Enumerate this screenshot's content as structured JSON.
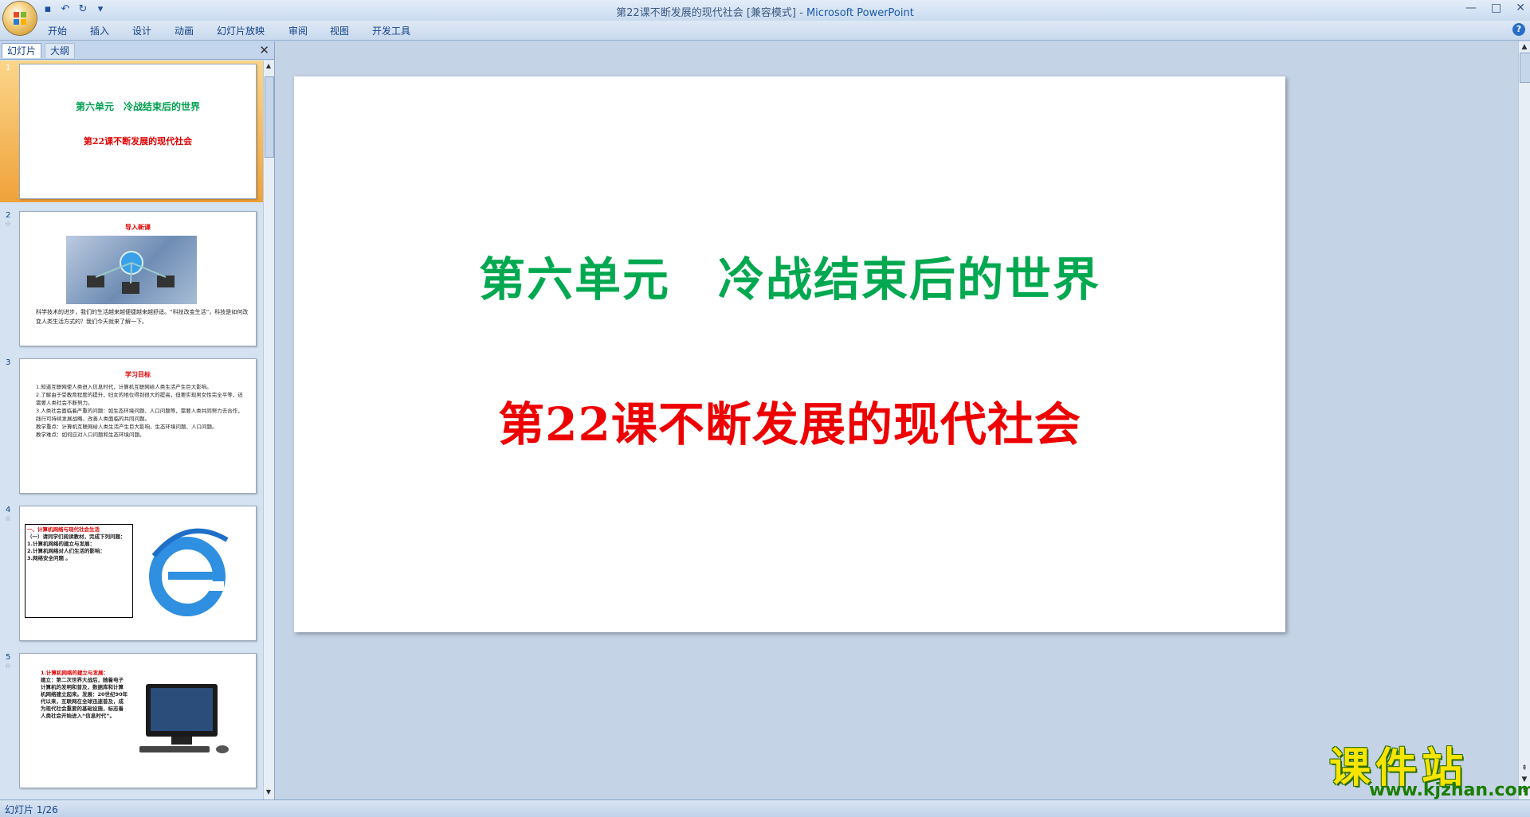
{
  "window": {
    "title": "第22课不断发展的现代社会 [兼容模式]",
    "app_name": "Microsoft PowerPoint",
    "controls": [
      "—",
      "□",
      "✕"
    ]
  },
  "ribbon": {
    "tabs": [
      "开始",
      "插入",
      "设计",
      "动画",
      "幻灯片放映",
      "审阅",
      "视图",
      "开发工具"
    ]
  },
  "left_panel": {
    "tab_slides": "幻灯片",
    "tab_outline": "大纲",
    "close": "✕"
  },
  "thumbnails": {
    "s1": {
      "num": "1",
      "title": "第六单元　冷战结束后的世界",
      "subtitle": "第22课不断发展的现代社会"
    },
    "s2": {
      "num": "2",
      "heading": "导入新课",
      "text": "科学技术的进步，我们的生活越来越便捷越来越舒适。“科技改变生活”，科技是如何改变人类生活方式的？我们今天就来了解一下。"
    },
    "s3": {
      "num": "3",
      "heading": "学习目标",
      "text": "1.知道互联网使人类进入信息时代，计算机互联网给人类生活产生巨大影响。\n2.了解由于受教育程度的提升，妇女的地位得到很大的提高，但要实现男女性完全平等，还需要人类社会不断努力。\n3.人类社会面临着严重的问题：如生态环境问题、人口问题等，需要人类共同努力去合作，践行可持续发展战略，改善人类面临的共同问题。\n教学重点：计算机互联网给人类生活产生巨大影响，生态环境问题、人口问题。\n教学难点：如何应对人口问题和生态环境问题。"
    },
    "s4": {
      "num": "4",
      "l1": "一、计算机网络与现代社会生活",
      "l2": "（一）请同学们阅读教材，完成下列问题：",
      "l3": "1.计算机网络的建立与发展：",
      "l4": "2.计算机网络对人们生活的影响：",
      "l5": "3.网络安全问题 。"
    },
    "s5": {
      "num": "5",
      "h": "1.计算机网络的建立与发展：",
      "text": "建立：第二次世界大战后，随着电子计算机的发明和普及，数据库和计算机网络建立起来。发展：20世纪90年代以来，互联网在全球迅速普及，成为现代社会重要的基础设施，标志着人类社会开始进入“信息时代”。"
    }
  },
  "main_slide": {
    "title": "第六单元　冷战结束后的世界",
    "subtitle": "第22课不断发展的现代社会",
    "title_color": "#00a84f",
    "subtitle_color": "#ee0000"
  },
  "status": {
    "slide_counter": "幻灯片 1/26"
  },
  "watermark": {
    "cn": "课件站",
    "url": "www.kjzhan.com"
  }
}
